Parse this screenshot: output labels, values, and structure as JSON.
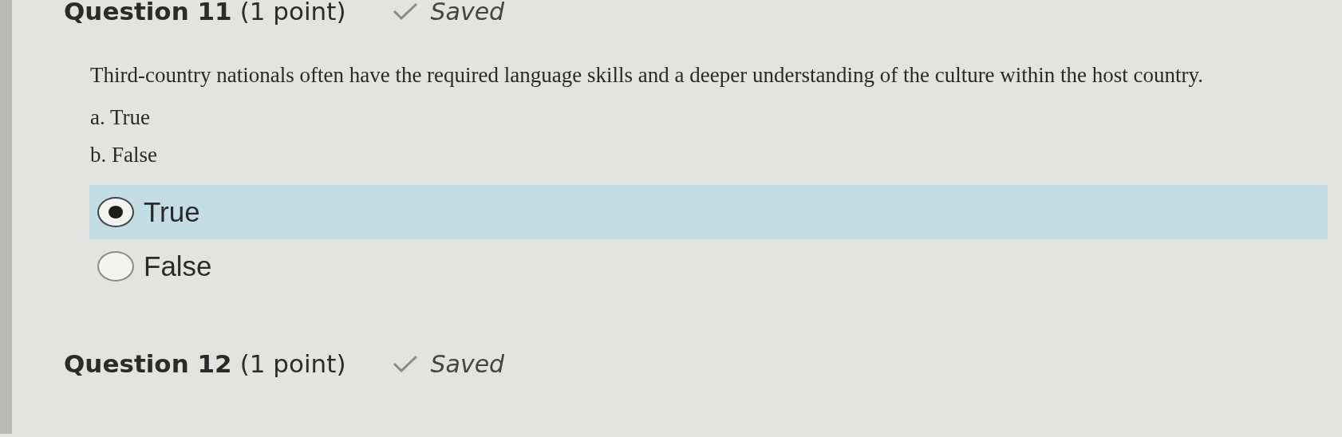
{
  "questions": [
    {
      "title": "Question 11",
      "points": "(1 point)",
      "status": "Saved",
      "text": "Third-country nationals often have the required language skills and a deeper understanding of the culture within the host country.",
      "choices": [
        {
          "letter": "a.",
          "label": "True"
        },
        {
          "letter": "b.",
          "label": "False"
        }
      ],
      "answers": [
        {
          "label": "True",
          "selected": true
        },
        {
          "label": "False",
          "selected": false
        }
      ]
    },
    {
      "title": "Question 12",
      "points": "(1 point)",
      "status": "Saved"
    }
  ]
}
